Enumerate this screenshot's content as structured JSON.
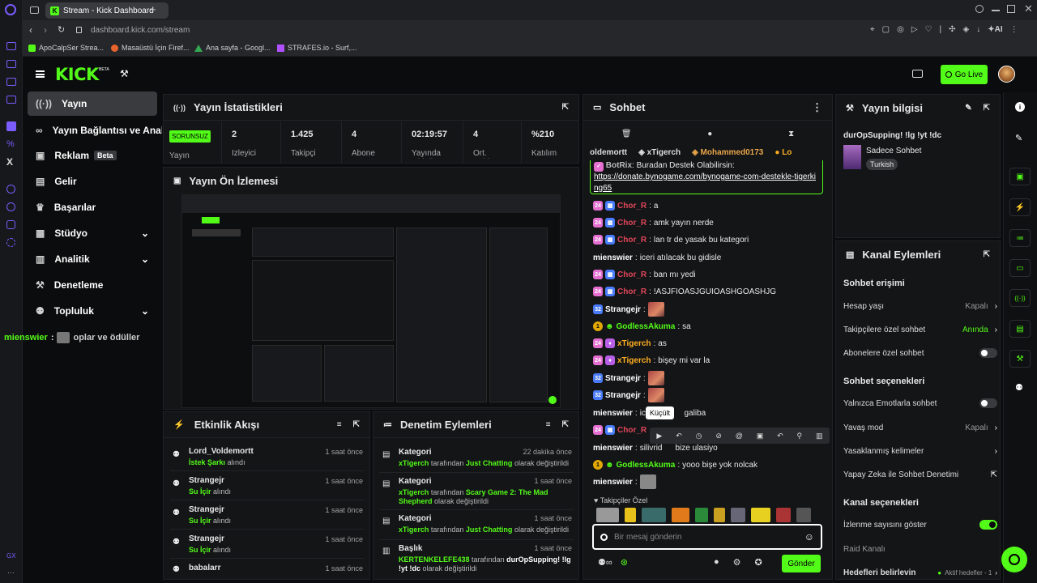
{
  "browser": {
    "tab_title": "Stream - Kick Dashboard",
    "url_host": "dashboard.kick.com",
    "url_path": "/stream",
    "bookmarks": [
      "ApoCalpSer Strea...",
      "Masaüstü İçin Firef...",
      "Ana sayfa - Googl...",
      "STRAFES.io - Surf,..."
    ],
    "ai_label": "AI"
  },
  "header": {
    "logo": "KICK",
    "logo_beta": "BETA",
    "go_live": "Go Live"
  },
  "sidebar": {
    "items": [
      {
        "label": "Yayın",
        "active": true
      },
      {
        "label": "Yayın Bağlantısı ve Anahtarı"
      },
      {
        "label": "Reklam",
        "badge": "Beta"
      },
      {
        "label": "Gelir"
      },
      {
        "label": "Başarılar"
      },
      {
        "label": "Stüdyo"
      },
      {
        "label": "Analitik"
      },
      {
        "label": "Denetleme"
      },
      {
        "label": "Topluluk"
      }
    ],
    "overlay_user": "mienswier",
    "overlay_text": "oplar ve ödüller"
  },
  "stats": {
    "title": "Yayın İstatistikleri",
    "status": "SORUNSUZ",
    "status_label": "Yayın",
    "items": [
      {
        "value": "2",
        "label": "İzleyici"
      },
      {
        "value": "1.425",
        "label": "Takipçi"
      },
      {
        "value": "4",
        "label": "Abone Sayısı"
      },
      {
        "value": "02:19:57",
        "label": "Yayında Olduğu"
      },
      {
        "value": "4",
        "label": "Ort. Sohbete"
      },
      {
        "value": "%210",
        "label": "Katılım"
      }
    ]
  },
  "preview": {
    "title": "Yayın Ön İzlemesi"
  },
  "activity": {
    "title": "Etkinlik Akışı",
    "rows": [
      {
        "name": "Lord_Voldemortt",
        "action": "İstek Şarkı",
        "suffix": "alındı",
        "time": "1 saat önce"
      },
      {
        "name": "Strangejr",
        "action": "Su İçir",
        "suffix": "alındı",
        "time": "1 saat önce"
      },
      {
        "name": "Strangejr",
        "action": "Su İçir",
        "suffix": "alındı",
        "time": "1 saat önce"
      },
      {
        "name": "Strangejr",
        "action": "Su İçir",
        "suffix": "alındı",
        "time": "1 saat önce"
      },
      {
        "name": "babalarr",
        "action": "",
        "suffix": "",
        "time": "1 saat önce"
      }
    ]
  },
  "moderation": {
    "title": "Denetim Eylemleri",
    "rows": [
      {
        "name": "Kategori",
        "user": "xTigerch",
        "mid": "tarafından",
        "value": "Just Chatting",
        "end": "olarak değiştirildi",
        "time": "22 dakika önce"
      },
      {
        "name": "Kategori",
        "user": "xTigerch",
        "mid": "tarafından",
        "value": "Scary Game 2: The Mad Shepherd",
        "end": "olarak değiştirildi",
        "time": "1 saat önce"
      },
      {
        "name": "Kategori",
        "user": "xTigerch",
        "mid": "tarafından",
        "value": "Just Chatting",
        "end": "olarak değiştirildi",
        "time": "1 saat önce"
      },
      {
        "name": "Başlık",
        "user": "KERTENKELEFE438",
        "mid": "tarafından",
        "value": "durOpSupping! !lg !yt !dc",
        "end": "olarak değiştirildi",
        "time": "1 saat önce"
      }
    ]
  },
  "chat": {
    "title": "Sohbet",
    "top_users": [
      "oldemortt",
      "xTigerch",
      "Mohammed0173",
      "Lo"
    ],
    "bot_user": "BotRix",
    "bot_text": "Buradan Destek Olabilirsin:",
    "bot_link": "https://donate.bynogame.com/bynogame-com-destekle-tigerking65",
    "messages": [
      {
        "user": "Chor_R",
        "color": "#e0465a",
        "text": "a"
      },
      {
        "user": "Chor_R",
        "color": "#e0465a",
        "text": "amk yayın nerde"
      },
      {
        "user": "Chor_R",
        "color": "#e0465a",
        "text": "lan tr de yasak bu kategori"
      },
      {
        "user": "mienswier",
        "color": "#ffffff",
        "text": "iceri atılacak bu gidisle"
      },
      {
        "user": "Chor_R",
        "color": "#e0465a",
        "text": "ban mı yedi"
      },
      {
        "user": "Chor_R",
        "color": "#e0465a",
        "text": "!ASJFIOASJGUIOASHGOASHJG"
      },
      {
        "user": "Strangejr",
        "color": "#ffffff",
        "text": ""
      },
      {
        "user": "GodlessAkuma",
        "color": "#53fc18",
        "text": "sa"
      },
      {
        "user": "xTigerch",
        "color": "#ffb020",
        "text": "as"
      },
      {
        "user": "xTigerch",
        "color": "#ffb020",
        "text": "bişey mi var la"
      },
      {
        "user": "Strangejr",
        "color": "#ffffff",
        "text": ""
      },
      {
        "user": "Strangejr",
        "color": "#ffffff",
        "text": ""
      },
      {
        "user": "mienswier",
        "color": "#ffffff",
        "text": "ice",
        "text2": "galiba"
      },
      {
        "user": "Chor_R",
        "color": "#e0465a",
        "text": ""
      },
      {
        "user": "mienswier",
        "color": "#ffffff",
        "text": "silivrid",
        "text2": "bize ulasiyo"
      },
      {
        "user": "GodlessAkuma",
        "color": "#53fc18",
        "text": "yooo bişe yok nolcak"
      },
      {
        "user": "mienswier",
        "color": "#ffffff",
        "text": ""
      }
    ],
    "tooltip": "Küçült",
    "follower_only": "Takipçiler Özel",
    "input_placeholder": "Bir mesaj gönderin",
    "send": "Gönder"
  },
  "stream_info": {
    "title": "Yayın bilgisi",
    "stream_title": "durOpSupping! !lg !yt !dc",
    "category": "Sadece Sohbet",
    "language": "Turkish"
  },
  "channel_actions": {
    "title": "Kanal Eylemleri",
    "chat_access": "Sohbet erişimi",
    "account_age": "Hesap yaşı",
    "account_age_value": "Kapalı",
    "follower_chat": "Takipçilere özel sohbet",
    "follower_chat_value": "Anında",
    "sub_chat": "Abonelere özel sohbet",
    "chat_options": "Sohbet seçenekleri",
    "emote_only": "Yalnızca Emotlarla sohbet",
    "slow_mode": "Yavaş mod",
    "slow_mode_value": "Kapalı",
    "banned_words": "Yasaklanmış kelimeler",
    "ai_moderation": "Yapay Zeka ile Sohbet Denetimi",
    "channel_options": "Kanal seçenekleri",
    "show_views": "İzlenme sayısını göster",
    "raid": "Raid Kanalı",
    "goals": "Hedefleri belirlevin",
    "goals_value": "Aktif hedefler - 1"
  },
  "colors": {
    "accent": "#53fc18",
    "bg": "#0b0c0d",
    "panel": "#141517"
  }
}
